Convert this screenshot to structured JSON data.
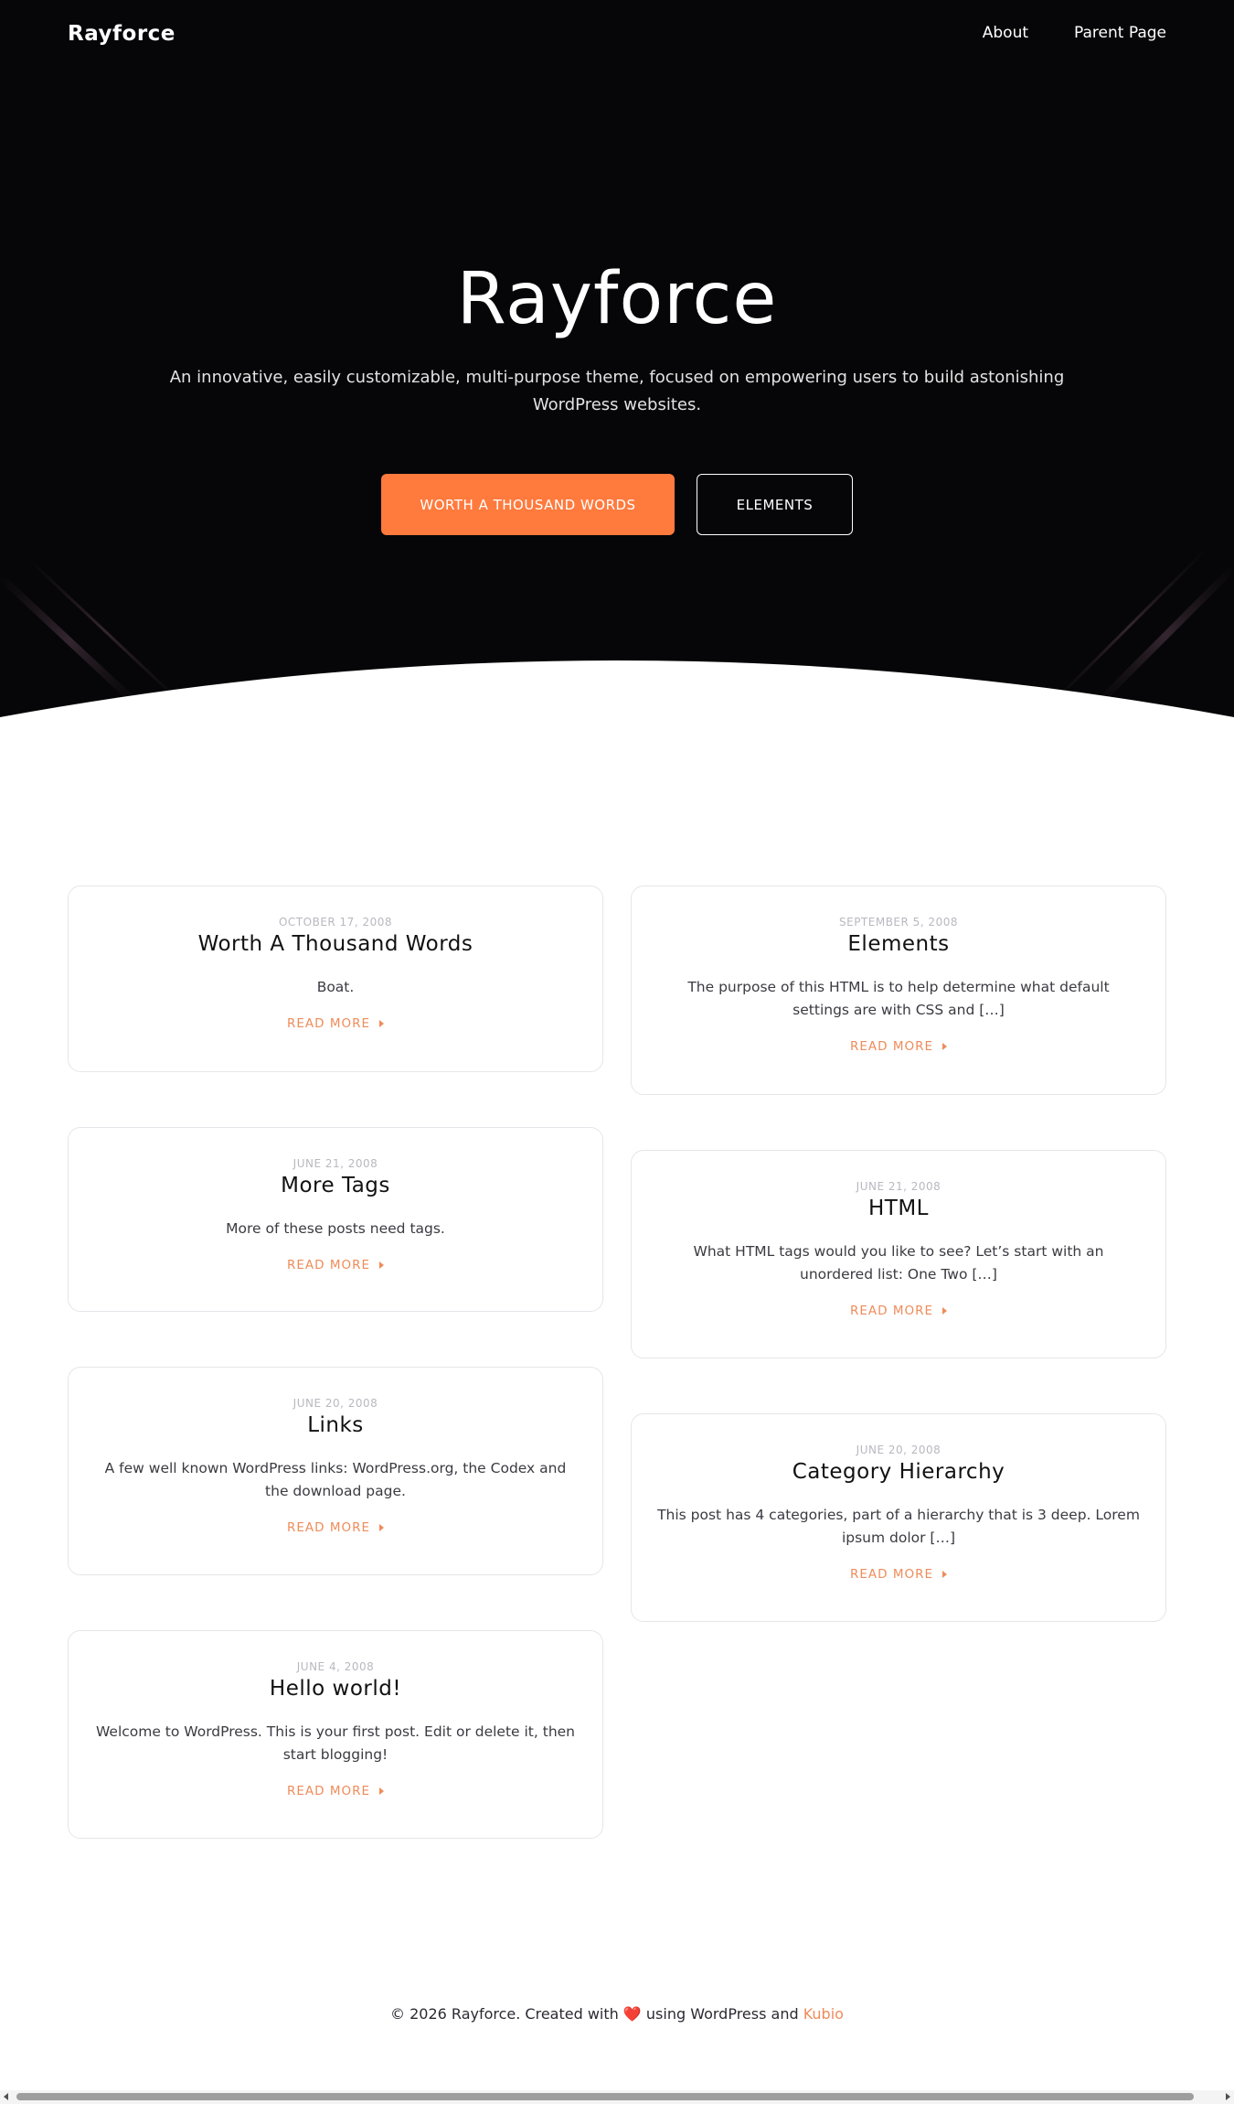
{
  "site": {
    "logo": "Rayforce",
    "nav": [
      "About",
      "Parent Page"
    ]
  },
  "hero": {
    "title": "Rayforce",
    "subtitle": "An innovative, easily customizable, multi-purpose theme, focused on empowering users to build astonishing WordPress websites.",
    "primary_button": "WORTH A THOUSAND WORDS",
    "secondary_button": "ELEMENTS"
  },
  "posts": [
    {
      "date": "OCTOBER 17, 2008",
      "title": "Worth A Thousand Words",
      "excerpt": "Boat.",
      "more": "READ MORE"
    },
    {
      "date": "SEPTEMBER 5, 2008",
      "title": "Elements",
      "excerpt": "The purpose of this HTML is to help determine what default settings are with CSS and […]",
      "more": "READ MORE"
    },
    {
      "date": "JUNE 21, 2008",
      "title": "More Tags",
      "excerpt": "More of these posts need tags.",
      "more": "READ MORE"
    },
    {
      "date": "JUNE 21, 2008",
      "title": "HTML",
      "excerpt": "What HTML tags would you like to see? Let’s start with an unordered list: One Two […]",
      "more": "READ MORE"
    },
    {
      "date": "JUNE 20, 2008",
      "title": "Links",
      "excerpt": "A few well known WordPress links: WordPress.org, the Codex and the download page.",
      "more": "READ MORE"
    },
    {
      "date": "JUNE 20, 2008",
      "title": "Category Hierarchy",
      "excerpt": "This post has 4 categories, part of a hierarchy that is 3 deep. Lorem ipsum dolor […]",
      "more": "READ MORE"
    },
    {
      "date": "JUNE 4, 2008",
      "title": "Hello world!",
      "excerpt": "Welcome to WordPress. This is your first post. Edit or delete it, then start blogging!",
      "more": "READ MORE"
    }
  ],
  "footer": {
    "prefix": "© 2026 Rayforce. Created with",
    "heart": "❤️",
    "middle": "using WordPress and",
    "link": "Kubio"
  },
  "colors": {
    "hero_bg": "#060608",
    "accent": "#ff7a3d",
    "read_more": "#ee8c5a"
  }
}
